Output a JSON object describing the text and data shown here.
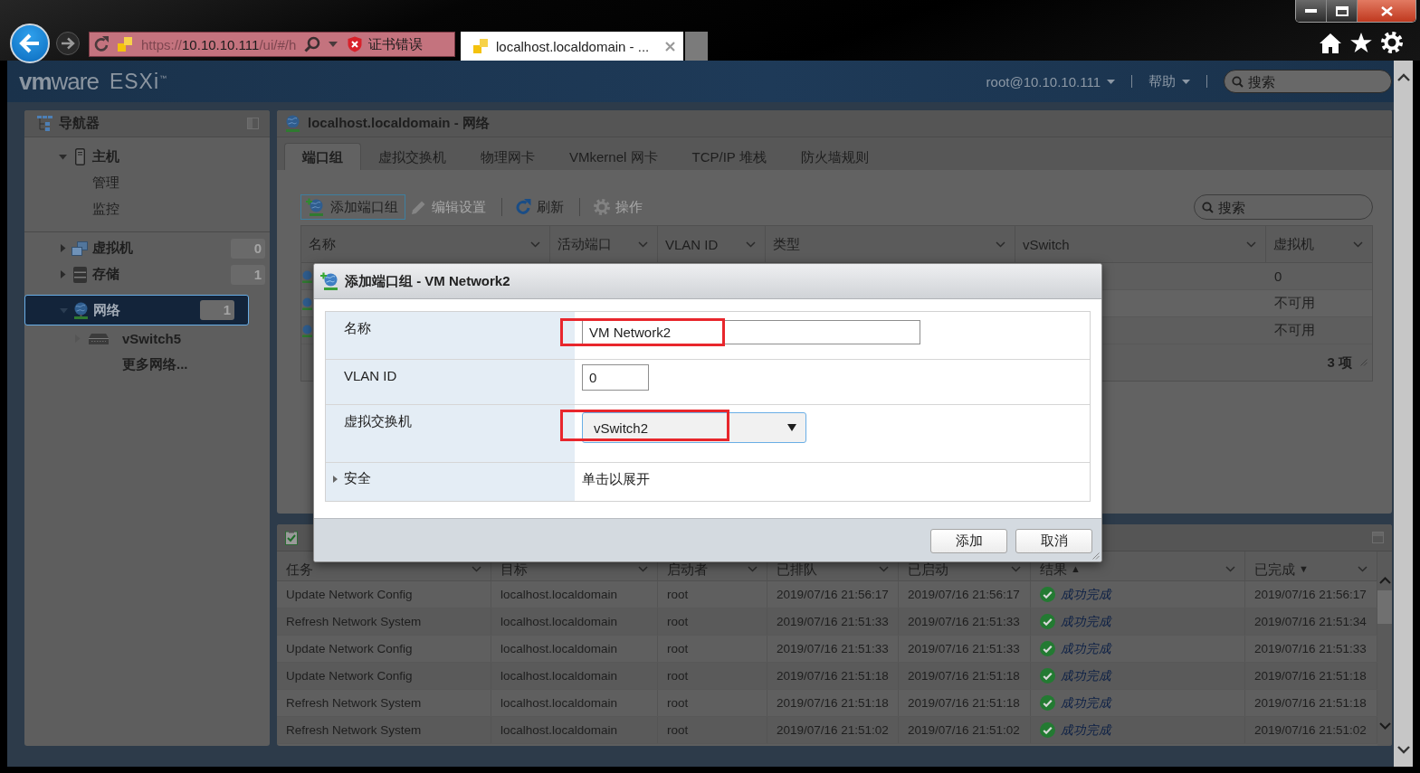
{
  "browser": {
    "address_bar": {
      "url_scheme": "https://",
      "url_host": "10.10.10.111",
      "url_path": "/ui/#/h",
      "certificate_error": "证书错误"
    },
    "tabs": [
      {
        "title": "localhost.localdomain - ...",
        "selected": true
      }
    ]
  },
  "header": {
    "logo": "**vm**ware",
    "product": "ESXi$^{™}$",
    "user_menu": "root@10.10.10.111",
    "help_menu": "帮助",
    "search": {
      "placeholder": "搜索"
    }
  },
  "navigator": {
    "title": "导航器",
    "sections": [
      {
        "items": [
          {
            "label": "主机",
            "kind": "host",
            "expanded": true,
            "selected": false,
            "children": [
              {
                "label": "管理",
                "selected": false
              },
              {
                "label": "监控",
                "selected": false
              }
            ]
          }
        ]
      },
      {
        "items": [
          {
            "label": "虚拟机",
            "kind": "vm",
            "expanded": false,
            "selected": false,
            "count": "0"
          },
          {
            "label": "存储",
            "kind": "storage",
            "expanded": false,
            "selected": false,
            "count": "1"
          },
          {
            "label": "网络",
            "kind": "network",
            "expanded": true,
            "selected": true,
            "count": "1",
            "children": [
              {
                "label": "vSwitch5",
                "kind": "switch",
                "expanded": false,
                "selected": false
              },
              {
                "label": "更多网络...",
                "selected": false
              }
            ]
          }
        ]
      }
    ]
  },
  "content": {
    "title": "localhost.localdomain - 网络",
    "tabs": [
      {
        "label": "端口组",
        "selected": true
      },
      {
        "label": "虚拟交换机",
        "selected": false
      },
      {
        "label": "物理网卡",
        "selected": false
      },
      {
        "label": "VMkernel 网卡",
        "selected": false
      },
      {
        "label": "TCP/IP 堆栈",
        "selected": false
      },
      {
        "label": "防火墙规则",
        "selected": false
      }
    ],
    "toolbar": {
      "groups": [
        {
          "buttons": [
            {
              "label": "添加端口组",
              "kind": "add",
              "disabled": false,
              "focused": true
            },
            {
              "label": "编辑设置",
              "kind": "edit",
              "disabled": true,
              "focused": false
            }
          ]
        },
        {
          "buttons": [
            {
              "label": "刷新",
              "kind": "refresh",
              "disabled": false,
              "focused": false
            }
          ]
        },
        {
          "buttons": [
            {
              "label": "操作",
              "kind": "actions",
              "disabled": true,
              "focused": false
            }
          ]
        }
      ]
    },
    "search": {
      "placeholder": "搜索"
    },
    "table": {
      "columns": [
        "名称",
        "活动端口",
        "VLAN ID",
        "类型",
        "vSwitch",
        "虚拟机"
      ],
      "rows": [
        {
          "virtual_machines": "0"
        },
        {
          "virtual_machines": "不可用"
        },
        {
          "virtual_machines": "不可用"
        }
      ],
      "footer": "3 项"
    }
  },
  "recent_tasks": {
    "columns": [
      {
        "label": "任务"
      },
      {
        "label": "目标"
      },
      {
        "label": "启动者"
      },
      {
        "label": "已排队"
      },
      {
        "label": "已启动"
      },
      {
        "label": "结果",
        "sort_indicator": "▲"
      },
      {
        "label": "已完成",
        "sort_indicator": "▼"
      }
    ],
    "rows": [
      {
        "kind": "success",
        "task": "Update Network Config",
        "target": "localhost.localdomain",
        "initiator": "root",
        "queued": "2019/07/16 21:56:17",
        "started": "2019/07/16 21:56:17",
        "result": "成功完成",
        "completed": "2019/07/16 21:56:17"
      },
      {
        "kind": "success",
        "task": "Refresh Network System",
        "target": "localhost.localdomain",
        "initiator": "root",
        "queued": "2019/07/16 21:51:33",
        "started": "2019/07/16 21:51:33",
        "result": "成功完成",
        "completed": "2019/07/16 21:51:34"
      },
      {
        "kind": "success",
        "task": "Update Network Config",
        "target": "localhost.localdomain",
        "initiator": "root",
        "queued": "2019/07/16 21:51:33",
        "started": "2019/07/16 21:51:33",
        "result": "成功完成",
        "completed": "2019/07/16 21:51:33"
      },
      {
        "kind": "success",
        "task": "Update Network Config",
        "target": "localhost.localdomain",
        "initiator": "root",
        "queued": "2019/07/16 21:51:18",
        "started": "2019/07/16 21:51:18",
        "result": "成功完成",
        "completed": "2019/07/16 21:51:18"
      },
      {
        "kind": "success",
        "task": "Refresh Network System",
        "target": "localhost.localdomain",
        "initiator": "root",
        "queued": "2019/07/16 21:51:18",
        "started": "2019/07/16 21:51:18",
        "result": "成功完成",
        "completed": "2019/07/16 21:51:18"
      },
      {
        "kind": "success",
        "task": "Refresh Network System",
        "target": "localhost.localdomain",
        "initiator": "root",
        "queued": "2019/07/16 21:51:02",
        "started": "2019/07/16 21:51:02",
        "result": "成功完成",
        "completed": "2019/07/16 21:51:02"
      }
    ]
  },
  "dialog": {
    "title": "添加端口组 - VM Network2",
    "fields": [
      {
        "kind": "text",
        "label": "名称",
        "value": "VM Network2",
        "annotated": true
      },
      {
        "kind": "number",
        "label": "VLAN ID",
        "value": "0"
      },
      {
        "kind": "select",
        "label": "虚拟交换机",
        "value": "vSwitch2",
        "annotated": true
      },
      {
        "kind": "section",
        "label": "安全",
        "value": "单击以展开",
        "expanded": false
      }
    ],
    "buttons": [
      {
        "label": "添加"
      },
      {
        "label": "取消"
      }
    ]
  }
}
